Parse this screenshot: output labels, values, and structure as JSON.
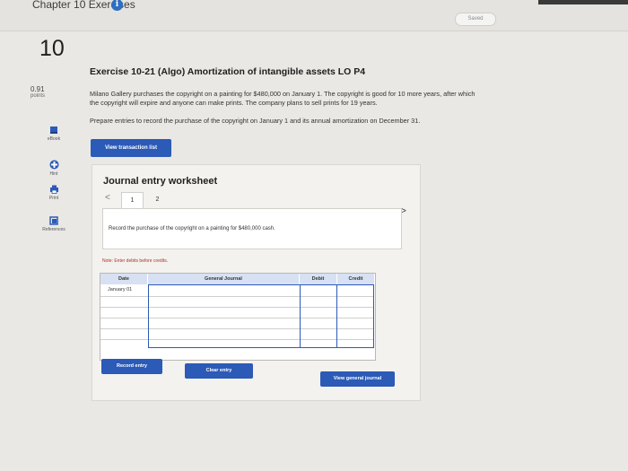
{
  "header": {
    "chapter_title": "Chapter 10 Exercises",
    "saved_label": "Saved"
  },
  "sidebar": {
    "question_number": "10",
    "points_value": "0.91",
    "points_label": "points",
    "items": [
      {
        "label": "eBook",
        "icon": "ebook-icon"
      },
      {
        "label": "Hint",
        "icon": "hint-icon"
      },
      {
        "label": "Print",
        "icon": "print-icon"
      },
      {
        "label": "References",
        "icon": "references-icon"
      }
    ]
  },
  "exercise": {
    "title": "Exercise 10-21 (Algo) Amortization of intangible assets LO P4",
    "problem_line1": "Milano Gallery purchases the copyright on a painting for $480,000 on January 1. The copyright is good for 10 more years, after which",
    "problem_line2": "the copyright will expire and anyone can make prints. The company plans to sell prints for 19 years.",
    "prepare": "Prepare entries to record the purchase of the copyright on January 1 and its annual amortization on December 31.",
    "view_transaction_list": "View transaction list"
  },
  "worksheet": {
    "title": "Journal entry worksheet",
    "prev_nav": "<",
    "next_nav": ">",
    "pages": [
      "1",
      "2"
    ],
    "task_text": "Record the purchase of the copyright on a painting for $480,000 cash.",
    "note": "Note: Enter debits before credits.",
    "columns": {
      "date": "Date",
      "general_journal": "General Journal",
      "debit": "Debit",
      "credit": "Credit"
    },
    "rows": [
      {
        "date": "January 01"
      },
      {
        "date": ""
      },
      {
        "date": ""
      },
      {
        "date": ""
      },
      {
        "date": ""
      },
      {
        "date": ""
      }
    ],
    "record_entry": "Record entry",
    "clear_entry": "Clear entry",
    "view_general_journal": "View general journal"
  },
  "colors": {
    "accent": "#2b5ab7",
    "header_fill": "#d8e1f3",
    "note": "#b0302a"
  }
}
